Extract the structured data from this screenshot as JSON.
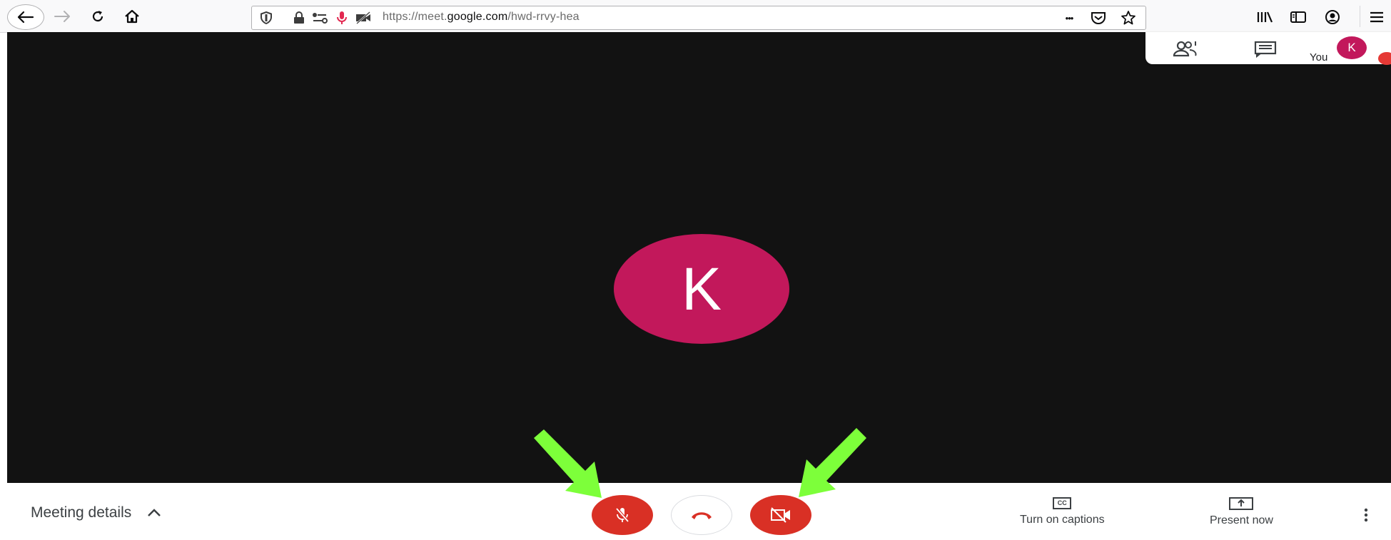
{
  "browser": {
    "url_prefix": "https://meet.",
    "url_domain": "google.com",
    "url_path": "/hwd-rrvy-hea",
    "more_label": "•••"
  },
  "panel": {
    "you_label": "You",
    "avatar_initial": "K"
  },
  "stage": {
    "avatar_initial": "K",
    "avatar_color": "#c2185b",
    "background": "#121212"
  },
  "bottom_bar": {
    "meeting_details_label": "Meeting details",
    "captions_label": "Turn on captions",
    "captions_icon_text": "CC",
    "present_label": "Present now",
    "mic_state": "off",
    "camera_state": "off",
    "accent_red": "#d93025"
  },
  "annotations": {
    "arrow_color": "#7dff3a"
  }
}
